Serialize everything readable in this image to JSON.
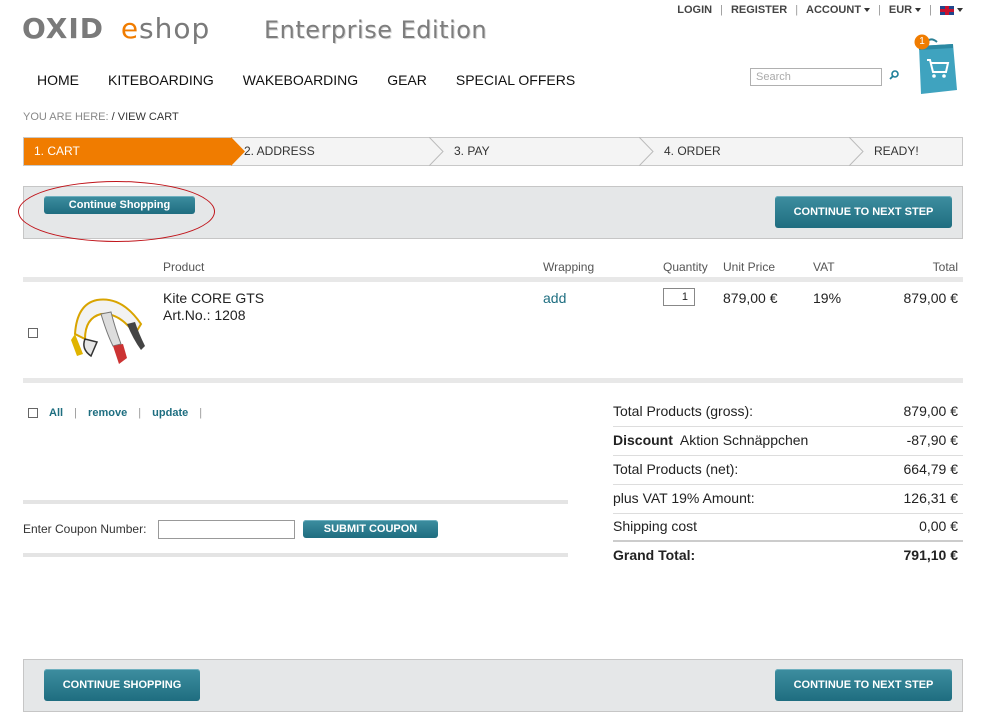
{
  "header": {
    "logo_oxid": "OXID",
    "logo_e": "e",
    "logo_shop": "shop",
    "edition": "Enterprise Edition",
    "top_links": {
      "login": "LOGIN",
      "register": "REGISTER",
      "account": "ACCOUNT",
      "currency": "EUR"
    },
    "language_icon": "uk-flag-icon",
    "nav": [
      "HOME",
      "KITEBOARDING",
      "WAKEBOARDING",
      "GEAR",
      "SPECIAL OFFERS"
    ],
    "search_placeholder": "Search",
    "cart_count": "1"
  },
  "breadcrumb": {
    "prefix": "YOU ARE HERE:",
    "sep": "/",
    "current": "VIEW CART"
  },
  "steps": [
    "1. CART",
    "2. ADDRESS",
    "3. PAY",
    "4. ORDER",
    "READY!"
  ],
  "actions": {
    "continue_shopping_top": "Continue Shopping",
    "next_step_top": "CONTINUE TO NEXT STEP",
    "continue_shopping_bottom": "CONTINUE SHOPPING",
    "next_step_bottom": "CONTINUE TO NEXT STEP"
  },
  "table": {
    "headers": {
      "product": "Product",
      "wrapping": "Wrapping",
      "quantity": "Quantity",
      "unit_price": "Unit Price",
      "vat": "VAT",
      "total": "Total"
    },
    "item": {
      "name": "Kite CORE GTS",
      "artno": "Art.No.: 1208",
      "wrapping": "add",
      "quantity": "1",
      "unit_price": "879,00 €",
      "vat": "19%",
      "total": "879,00 €"
    }
  },
  "list_actions": {
    "all": "All",
    "remove": "remove",
    "update": "update"
  },
  "coupon": {
    "label": "Enter Coupon Number:",
    "button": "SUBMIT COUPON"
  },
  "totals": {
    "gross_label": "Total Products (gross):",
    "gross": "879,00 €",
    "discount_label": "Discount",
    "discount_name": "Aktion Schnäppchen",
    "discount": "-87,90 €",
    "net_label": "Total Products (net):",
    "net": "664,79 €",
    "vat_label": "plus VAT 19% Amount:",
    "vat": "126,31 €",
    "shipping_label": "Shipping cost",
    "shipping": "0,00 €",
    "grand_label": "Grand Total:",
    "grand": "791,10 €"
  },
  "colors": {
    "accent": "#f07c00",
    "button": "#2a7b8e",
    "annotation": "#c0151b"
  }
}
